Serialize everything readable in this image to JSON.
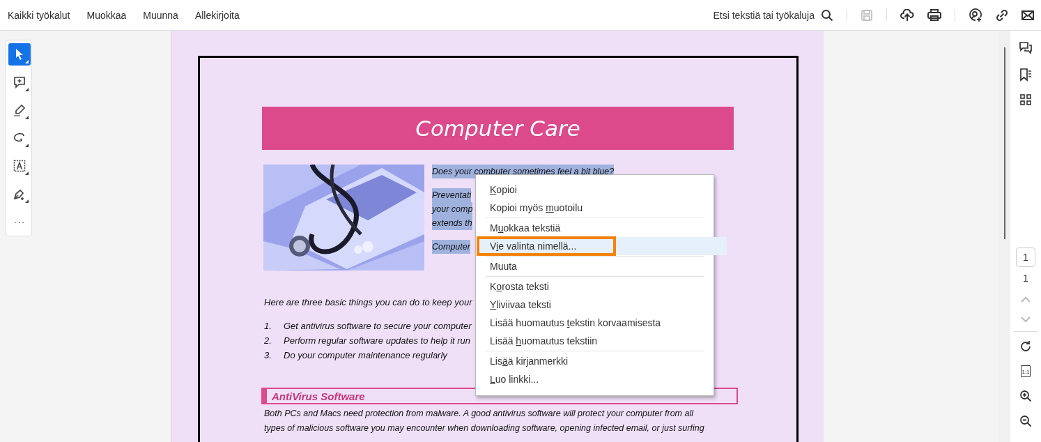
{
  "menubar": {
    "items": [
      "Kaikki työkalut",
      "Muokkaa",
      "Muunna",
      "Allekirjoita"
    ],
    "search_label": "Etsi tekstiä tai työkaluja",
    "actions": [
      {
        "kind": "save",
        "disabled": true
      },
      {
        "kind": "upload",
        "disabled": false
      },
      {
        "kind": "print",
        "disabled": false
      },
      {
        "kind": "share",
        "disabled": false
      },
      {
        "kind": "link",
        "disabled": false
      },
      {
        "kind": "mail",
        "disabled": false
      }
    ]
  },
  "tools": [
    {
      "kind": "select",
      "selected": true
    },
    {
      "kind": "comment",
      "selected": false
    },
    {
      "kind": "highlight",
      "selected": false
    },
    {
      "kind": "draw",
      "selected": false
    },
    {
      "kind": "textbox",
      "selected": false
    },
    {
      "kind": "sign",
      "selected": false
    },
    {
      "kind": "more",
      "selected": false,
      "label": "···"
    }
  ],
  "document": {
    "title": "Computer Care",
    "intro": [
      {
        "text": "Does your combuter sometimes feel a bit blue?",
        "highlighted": true
      },
      {
        "text": "Preventati",
        "highlighted": true
      },
      {
        "text": "your comp",
        "highlighted": true
      },
      {
        "text": "extends th",
        "highlighted": true
      },
      {
        "text": "Computer",
        "highlighted": true
      }
    ],
    "lead": "Here are three basic things you can do to keep your",
    "steps": [
      {
        "number": "1.",
        "text": "Get antivirus software to secure your computer"
      },
      {
        "number": "2.",
        "text": "Perform regular software updates to help it run"
      },
      {
        "number": "3.",
        "text": "Do your computer maintenance regularly"
      }
    ],
    "section_heading": "AntiVirus Software",
    "body": [
      "Both PCs and Macs need protection from malware.  A good antivirus software will protect your computer from all",
      "types of malicious software you may encounter when downloading software, opening infected email, or just surfing"
    ]
  },
  "context_menu": [
    {
      "key": "K",
      "post": "opioi",
      "selected": false,
      "divider_after": false
    },
    {
      "pre": "Kopioi myös ",
      "key": "m",
      "post": "uotoilu",
      "selected": false,
      "divider_after": true
    },
    {
      "pre": "M",
      "key": "u",
      "post": "okkaa tekstiä",
      "selected": false,
      "divider_after": false
    },
    {
      "pre": "V",
      "key": "i",
      "post": "e valinta nimellä...",
      "selected": true,
      "divider_after": true
    },
    {
      "pre": "Muuta",
      "selected": false,
      "divider_after": true
    },
    {
      "pre": "K",
      "key": "o",
      "post": "rosta teksti",
      "selected": false,
      "divider_after": false
    },
    {
      "key": "Y",
      "post": "liviivaa teksti",
      "selected": false,
      "divider_after": false
    },
    {
      "pre": "Lisää huomautus ",
      "key": "t",
      "post": "ekstin korvaamisesta",
      "selected": false,
      "divider_after": false
    },
    {
      "pre": "Lisää ",
      "key": "h",
      "post": "uomautus tekstiin",
      "selected": false,
      "divider_after": true
    },
    {
      "pre": "Lis",
      "key": "ä",
      "post": "ä kirjanmerkki",
      "selected": false,
      "divider_after": false
    },
    {
      "key": "L",
      "post": "uo linkki...",
      "selected": false,
      "divider_after": false
    }
  ],
  "right_rail": {
    "page_input": "1",
    "page_count": "1",
    "actual_size_label": "1:1"
  }
}
